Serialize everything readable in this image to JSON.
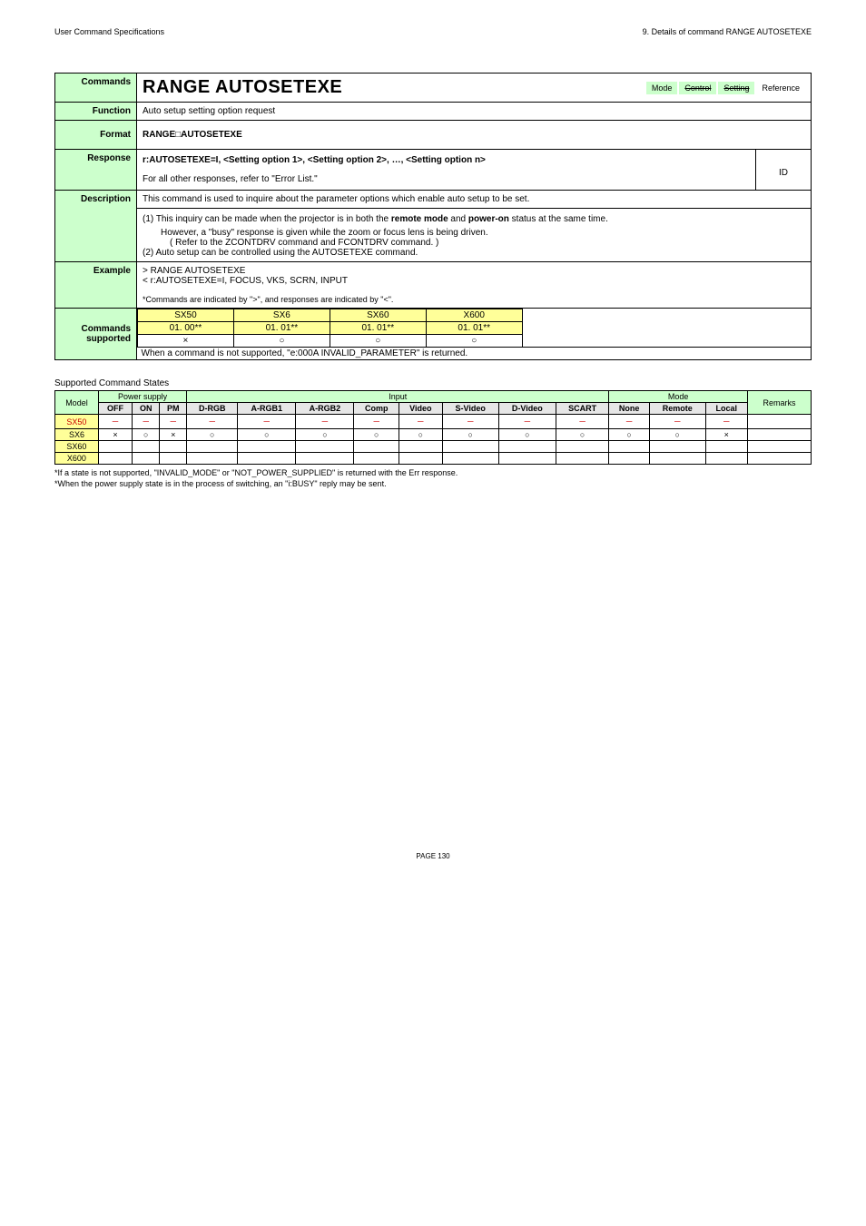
{
  "header": {
    "left": "User Command Specifications",
    "right": "9. Details of command  RANGE AUTOSETEXE"
  },
  "main": {
    "commands_label": "Commands",
    "title": "RANGE AUTOSETEXE",
    "tags": {
      "mode": "Mode",
      "control": "Control",
      "setting": "Setting",
      "reference": "Reference"
    },
    "function_label": "Function",
    "function_value": "Auto setup setting option request",
    "format_label": "Format",
    "format_value": "RANGE□AUTOSETEXE",
    "response_label": "Response",
    "response_line1": "r:AUTOSETEXE=I, <Setting option 1>, <Setting option 2>, …, <Setting option n>",
    "response_line2_prefix": "For all other responses, refer to ",
    "response_line2_link": "\"Error List.\"",
    "response_id": "ID",
    "description_label": "Description",
    "description_top": "This command is used to inquire about the parameter options which enable auto setup to be set.",
    "description_item1_a": "(1) This inquiry can be made when the projector is in both the ",
    "description_item1_b": "remote mode",
    "description_item1_c": " and ",
    "description_item1_d": "power-on",
    "description_item1_e": " status at the same time.",
    "description_item1_sub1": "However, a \"busy\" response is given while the zoom or focus lens is being driven.",
    "description_item1_sub2": "( Refer to the ZCONTDRV command and FCONTDRV command.  )",
    "description_item2": "(2) Auto setup can be controlled using the AUTOSETEXE command.",
    "example_label": "Example",
    "example_line1": "> RANGE AUTOSETEXE",
    "example_line2": "< r:AUTOSETEXE=I, FOCUS, VKS, SCRN, INPUT",
    "example_note": "*Commands are indicated by \">\", and responses are indicated by \"<\".",
    "supported_label1": "Commands",
    "supported_label2": "supported",
    "models": {
      "col1_name": "SX50",
      "col1_ver": "01. 00**",
      "col1_sym": "×",
      "col2_name": "SX6",
      "col2_ver": "01. 01**",
      "col2_sym": "○",
      "col3_name": "SX60",
      "col3_ver": "01. 01**",
      "col3_sym": "○",
      "col4_name": "X600",
      "col4_ver": "01. 01**",
      "col4_sym": "○"
    },
    "supported_note": "When a command is not supported, \"e:000A INVALID_PARAMETER\" is returned."
  },
  "states": {
    "title": "Supported Command States",
    "headers": {
      "model": "Model",
      "power_supply": "Power supply",
      "input": "Input",
      "mode": "Mode",
      "remarks": "Remarks",
      "off": "OFF",
      "on": "ON",
      "pm": "PM",
      "drgb": "D-RGB",
      "argb1": "A-RGB1",
      "argb2": "A-RGB2",
      "comp": "Comp",
      "video": "Video",
      "svideo": "S-Video",
      "dvideo": "D-Video",
      "scart": "SCART",
      "none": "None",
      "remote": "Remote",
      "local": "Local"
    },
    "rows": [
      {
        "model": "SX50",
        "cells": [
          "－",
          "－",
          "－",
          "－",
          "－",
          "－",
          "－",
          "－",
          "－",
          "－",
          "－",
          "－",
          "－",
          "－"
        ],
        "remarks": "",
        "red": true
      },
      {
        "model": "SX6",
        "cells": [
          "×",
          "○",
          "×",
          "○",
          "○",
          "○",
          "○",
          "○",
          "○",
          "○",
          "○",
          "○",
          "○",
          "×"
        ],
        "remarks": ""
      },
      {
        "model": "SX60",
        "cells": [
          "",
          "",
          "",
          "",
          "",
          "",
          "",
          "",
          "",
          "",
          "",
          "",
          "",
          ""
        ],
        "remarks": ""
      },
      {
        "model": "X600",
        "cells": [
          "",
          "",
          "",
          "",
          "",
          "",
          "",
          "",
          "",
          "",
          "",
          "",
          "",
          ""
        ],
        "remarks": ""
      }
    ]
  },
  "footnotes": {
    "line1": "*If a state is not supported, \"INVALID_MODE\" or \"NOT_POWER_SUPPLIED\" is returned with the Err response.",
    "line2": "*When the power supply state is in the process of switching, an \"i:BUSY\" reply may be sent."
  },
  "page_num": "PAGE 130"
}
